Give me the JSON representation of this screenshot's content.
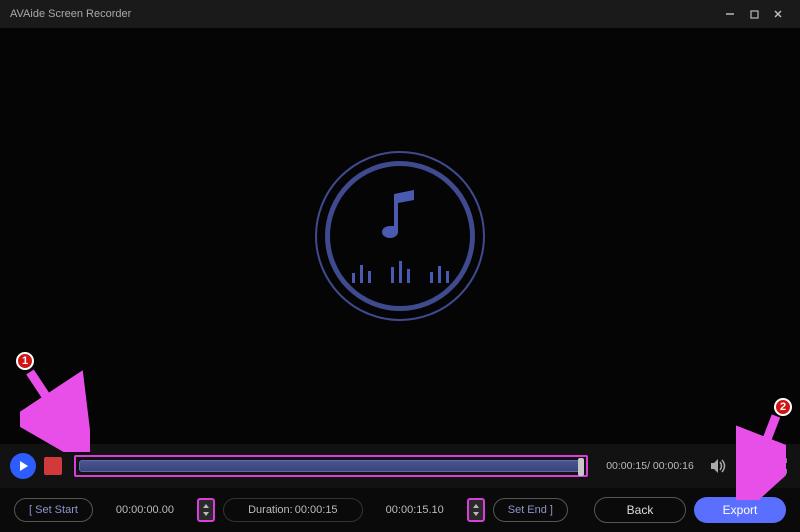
{
  "title": "AVAide Screen Recorder",
  "playback": {
    "current_time": "00:00:15",
    "total_time": "00:00:16"
  },
  "clip": {
    "set_start_label": "[ Set Start",
    "start_time": "00:00:00.00",
    "duration_label": "Duration:",
    "duration_value": "00:00:15",
    "end_time": "00:00:15.10",
    "set_end_label": "Set End ]"
  },
  "buttons": {
    "back": "Back",
    "export": "Export"
  },
  "annotations": {
    "one": "1",
    "two": "2"
  }
}
